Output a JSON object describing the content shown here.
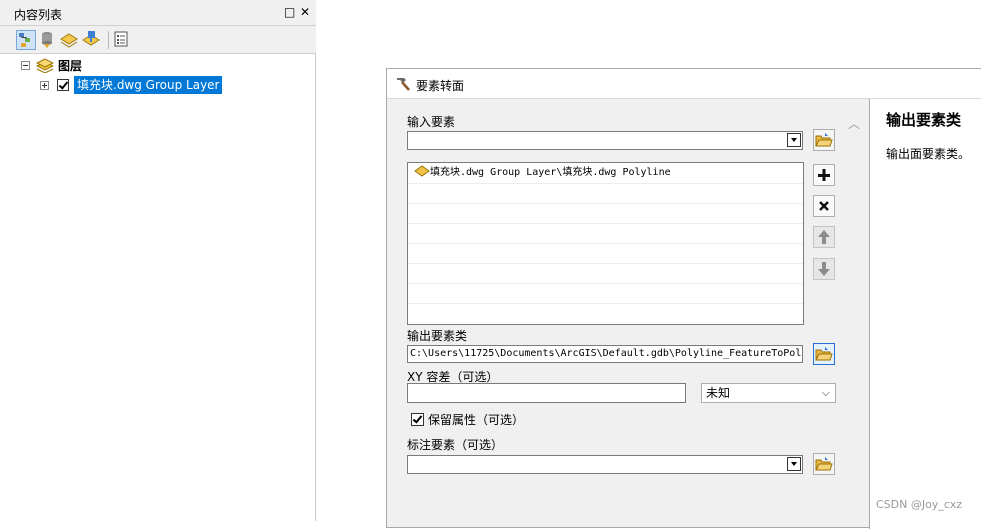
{
  "toc": {
    "title": "内容列表",
    "title_controls": {
      "float": "□",
      "close": "✕"
    },
    "toolbar": [
      {
        "icon": "list-by-drawing-order-icon",
        "active": true
      },
      {
        "icon": "list-by-source-icon",
        "active": false
      },
      {
        "icon": "list-by-visibility-icon",
        "active": false
      },
      {
        "icon": "list-by-selection-icon",
        "active": false
      },
      {
        "icon": "options-icon",
        "active": false
      }
    ],
    "tree": {
      "root_label": "图层",
      "root_icon": "layers-icon",
      "child_label": "填充块.dwg Group Layer",
      "child_checked": true,
      "child_selected": true
    }
  },
  "dialog": {
    "title": "要素转面",
    "title_icon": "hammer-tool-icon",
    "input_label": "输入要素",
    "input_value": "",
    "list_items": [
      "填充块.dwg Group Layer\\填充块.dwg Polyline"
    ],
    "buttons": {
      "add": "+",
      "remove": "×",
      "up": "↑",
      "down": "↓"
    },
    "output_label": "输出要素类",
    "output_value": "C:\\Users\\11725\\Documents\\ArcGIS\\Default.gdb\\Polyline_FeatureToPol",
    "xy_label": "XY 容差（可选）",
    "xy_value": "",
    "xy_unit": "未知",
    "preserve_label": "保留属性（可选）",
    "preserve_checked": true,
    "label_features_label": "标注要素（可选）",
    "label_features_value": "",
    "help": {
      "title": "输出要素类",
      "body": "输出面要素类。"
    }
  },
  "annotation": {
    "arrow_color": "#e02020"
  },
  "watermark": "CSDN @Joy_cxz"
}
